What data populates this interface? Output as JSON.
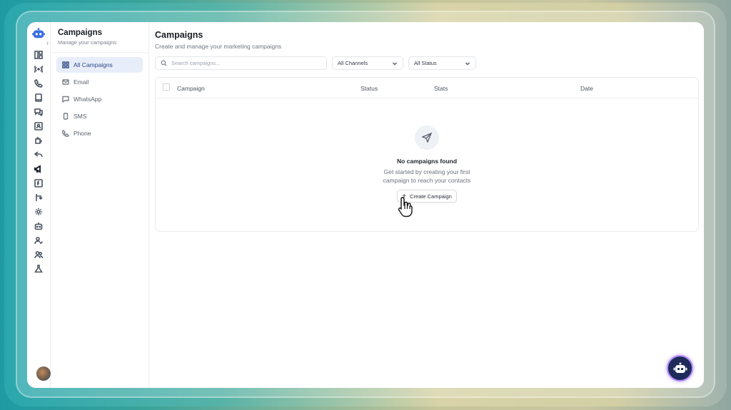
{
  "sidebar": {
    "title": "Campaigns",
    "subtitle": "Manage your campaigns",
    "items": [
      {
        "label": "All Campaigns"
      },
      {
        "label": "Email"
      },
      {
        "label": "WhatsApp"
      },
      {
        "label": "SMS"
      },
      {
        "label": "Phone"
      }
    ]
  },
  "main": {
    "title": "Campaigns",
    "subtitle": "Create and manage your marketing campaigns",
    "search_placeholder": "Search campaigns...",
    "channel_filter": "All Channels",
    "status_filter": "All Status",
    "columns": [
      "Campaign",
      "Status",
      "Stats",
      "Date"
    ],
    "empty": {
      "heading": "No campaigns found",
      "line1": "Get started by creating your first",
      "line2": "campaign to reach your contacts",
      "button": "Create Campaign"
    }
  },
  "colors": {
    "accent": "#2c4a86",
    "active_bg": "#e7edf9",
    "fab": "#1d2a5a"
  }
}
